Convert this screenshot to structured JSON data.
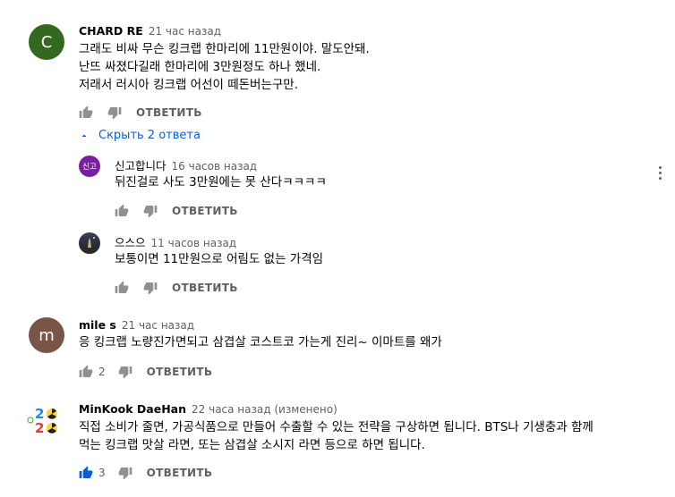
{
  "comments": [
    {
      "avatar_letter": "C",
      "avatar_color": "#33691e",
      "author": "CHARD RE",
      "time": "21 час назад",
      "text": "그래도 비싸 무슨 킹크랩 한마리에 11만원이야. 말도안돼.\n난뜨 싸졌다길래 한마리에 3만원정도 하나 했네.\n저래서 러시아 킹크랩 어선이 떼돈버는구만.",
      "like_count": "",
      "reply_label": "ОТВЕТИТЬ",
      "replies_toggle": "Скрыть 2 ответа",
      "replies": [
        {
          "avatar_text": "신고",
          "avatar_color": "#7b1fa2",
          "author": "신고합니다",
          "time": "16 часов назад",
          "text": "뒤진걸로 사도 3만원에는 못 산다ㅋㅋㅋㅋ",
          "reply_label": "ОТВЕТИТЬ"
        },
        {
          "author": "으스으",
          "time": "11 часов назад",
          "text": "보통이면 11만원으로 어림도 없는 가격임",
          "reply_label": "ОТВЕТИТЬ"
        }
      ]
    },
    {
      "avatar_letter": "m",
      "avatar_color": "#795548",
      "author": "mile s",
      "time": "21 час назад",
      "text": "응 킹크랩 노량진가면되고 삼겹살 코스트코 가는게 진리~ 이마트를 왜가",
      "like_count": "2",
      "reply_label": "ОТВЕТИТЬ"
    },
    {
      "author": "MinKook DaeHan",
      "time": "22 часа назад (изменено)",
      "text": "직접 소비가 줄면, 가공식품으로 만들어 수출할 수 있는 전략을 구상하면 됩니다. BTS나 기생충과 함께\n먹는 킹크랩 맛살 라면, 또는 삼겹살 소시지 라면 등으로 하면 됩니다.",
      "like_count": "3",
      "reply_label": "ОТВЕТИТЬ"
    }
  ],
  "colors": {
    "link_blue": "#065fd4",
    "like_active": "#065fd4",
    "icon_grey": "#606060"
  },
  "icons": {
    "like": "thumb-up-icon",
    "dislike": "thumb-down-icon",
    "toggle": "chevron-up-icon",
    "menu": "more-vert-icon"
  }
}
